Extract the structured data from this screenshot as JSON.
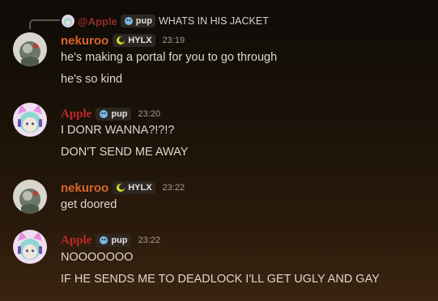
{
  "reply": {
    "author": "@Apple",
    "tag": "pup",
    "text": "WHATS IN HIS JACKET"
  },
  "messages": [
    {
      "author": "nekuroo",
      "tag": "HYLX",
      "time": "23:19",
      "lines": [
        "he's making a portal for you to go through",
        "he's so kind"
      ]
    },
    {
      "author": "Apple",
      "tag": "pup",
      "time": "23:20",
      "lines": [
        "I DONR WANNA?!?!?",
        "DON'T SEND ME AWAY"
      ]
    },
    {
      "author": "nekuroo",
      "tag": "HYLX",
      "time": "23:22",
      "lines": [
        "get doored"
      ]
    },
    {
      "author": "Apple",
      "tag": "pup",
      "time": "23:22",
      "lines": [
        "NOOOOOOO",
        "IF HE SENDS ME TO DEADLOCK I'LL GET UGLY AND GAY"
      ]
    }
  ],
  "colors": {
    "nekuroo": "#d9652b",
    "apple": "#c02626",
    "hylx_icon": "#d8e020",
    "pup_icon": "#7ab8e0"
  },
  "icons": {
    "hylx": "crescent-icon",
    "pup": "pup-icon"
  }
}
